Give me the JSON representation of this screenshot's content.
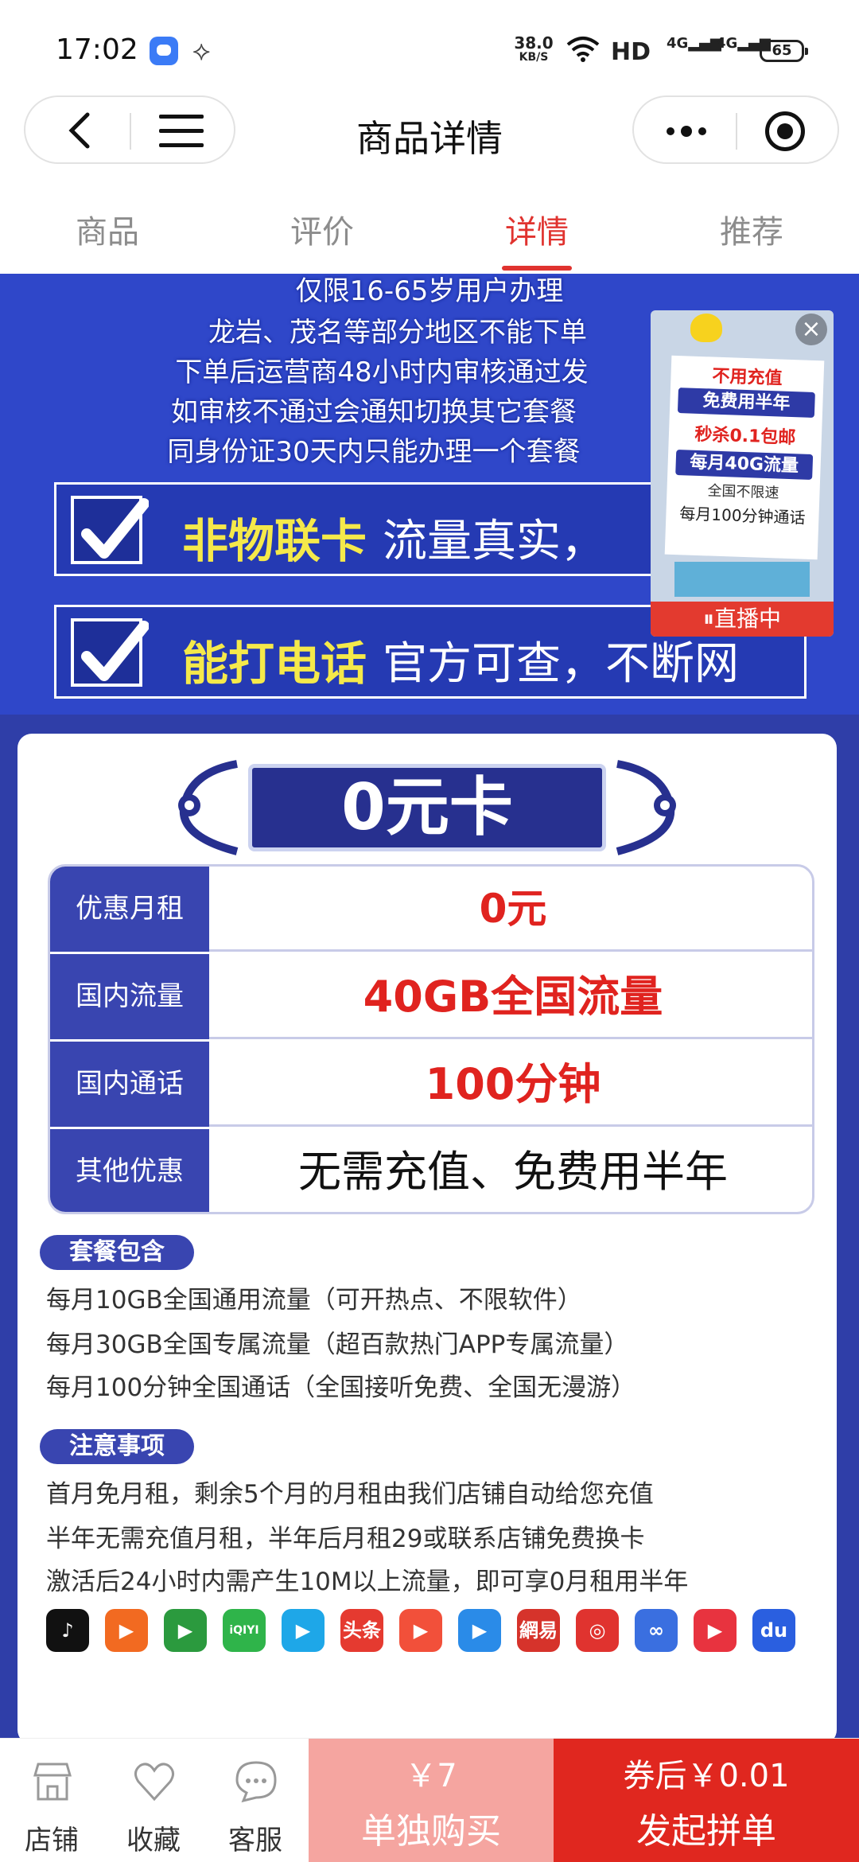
{
  "status_bar": {
    "time": "17:02",
    "net_speed": "38.0",
    "net_unit": "KB/S",
    "hd": "HD",
    "signal1": "4G",
    "signal2": "4G",
    "battery": "65"
  },
  "nav": {
    "title": "商品详情"
  },
  "tabs": [
    {
      "label": "商品"
    },
    {
      "label": "评价"
    },
    {
      "label": "详情"
    },
    {
      "label": "推荐"
    }
  ],
  "banner": {
    "lines": [
      "仅限16-65岁用户办理",
      "龙岩、茂名等部分地区不能下单",
      "下单后运营商48小时内审核通过发",
      "如审核不通过会通知切换其它套餐",
      "同身份证30天内只能办理一个套餐"
    ],
    "check1_highlight": "非物联卡",
    "check1_text": "流量真实，",
    "check2_highlight": "能打电话",
    "check2_text": "官方可查，不断网"
  },
  "live": {
    "l1": "不用充值",
    "l2": "免费用半年",
    "l3": "秒杀0.1包邮",
    "l4": "每月40G流量",
    "l5": "全国不限速",
    "l6": "每月100分钟通话",
    "status": "直播中",
    "close": "×"
  },
  "card": {
    "title": "0元卡",
    "spec_rows": [
      {
        "label": "优惠月租",
        "value": "0元"
      },
      {
        "label": "国内流量",
        "value": "40GB全国流量"
      },
      {
        "label": "国内通话",
        "value": "100分钟"
      },
      {
        "label": "其他优惠",
        "value": "无需充值、免费用半年"
      }
    ],
    "package_badge": "套餐包含",
    "package_lines": [
      "每月10GB全国通用流量（可开热点、不限软件）",
      "每月30GB全国专属流量（超百款热门APP专属流量）",
      "每月100分钟全国通话（全国接听免费、全国无漫游）"
    ],
    "notes_badge": "注意事项",
    "notes_lines": [
      "首月免月租，剩余5个月的月租由我们店铺自动给您充值",
      "半年无需充值月租，半年后月租29或联系店铺免费换卡",
      "激活后24小时内需产生10M以上流量，即可享0月租用半年"
    ],
    "apps": [
      {
        "name": "douyin-icon",
        "glyph": "♪",
        "color": "#111111"
      },
      {
        "name": "kuaishou-icon",
        "glyph": "▶",
        "color": "#f26a21"
      },
      {
        "name": "video-icon",
        "glyph": "▶",
        "color": "#2b9a3e"
      },
      {
        "name": "iqiyi-icon",
        "glyph": "iQIYI",
        "color": "#2fb44a"
      },
      {
        "name": "youku-icon",
        "glyph": "▶",
        "color": "#1ea7e8"
      },
      {
        "name": "toutiao-icon",
        "glyph": "头条",
        "color": "#e53a30"
      },
      {
        "name": "xigua-icon",
        "glyph": "▶",
        "color": "#f2503a"
      },
      {
        "name": "tencent-video-icon",
        "glyph": "▶",
        "color": "#2a8be8"
      },
      {
        "name": "netease-icon",
        "glyph": "網易",
        "color": "#d6332b"
      },
      {
        "name": "weibo-icon",
        "glyph": "◎",
        "color": "#e0332f"
      },
      {
        "name": "link-icon",
        "glyph": "∞",
        "color": "#3a6fe0"
      },
      {
        "name": "music-icon",
        "glyph": "▶",
        "color": "#e8333f"
      },
      {
        "name": "baidu-icon",
        "glyph": "du",
        "color": "#2a5fe0"
      }
    ]
  },
  "bottom_bar": {
    "shop": "店铺",
    "favorite": "收藏",
    "service": "客服",
    "single_price": "￥7",
    "single_label": "单独购买",
    "group_price": "券后￥0.01",
    "group_label": "发起拼单"
  },
  "colors": {
    "accent": "#e0332f",
    "banner": "#2f47c9",
    "label_bg": "#3945b0"
  }
}
